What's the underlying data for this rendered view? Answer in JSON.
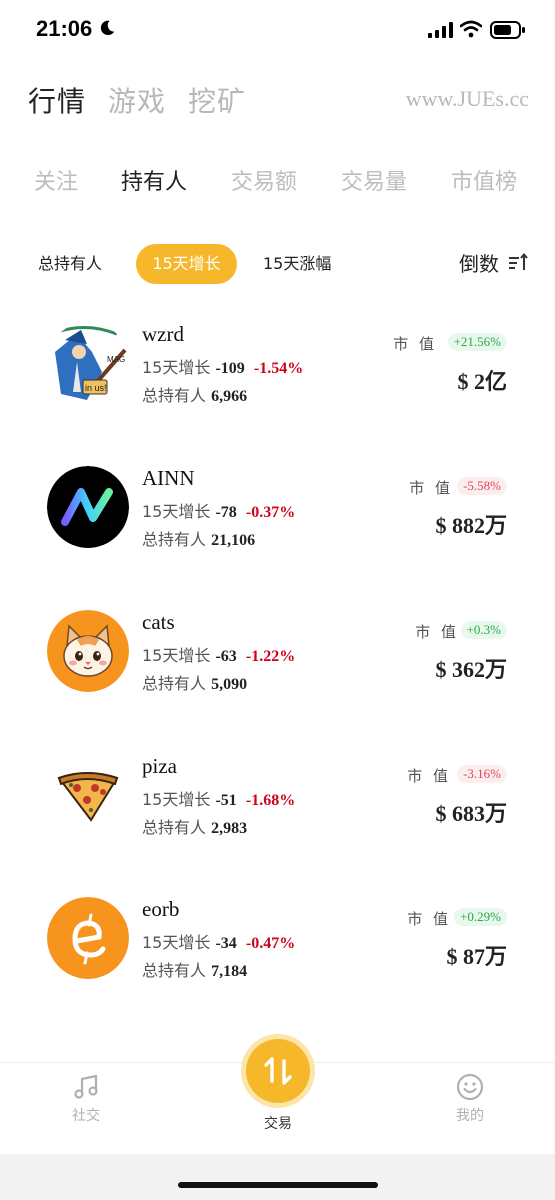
{
  "status": {
    "time": "21:06"
  },
  "top_tabs": [
    {
      "label": "行情",
      "active": true
    },
    {
      "label": "游戏",
      "active": false
    },
    {
      "label": "挖矿",
      "active": false
    }
  ],
  "site_url": "www.JUEs.cc",
  "sub_tabs": [
    {
      "label": "关注",
      "active": false
    },
    {
      "label": "持有人",
      "active": true
    },
    {
      "label": "交易额",
      "active": false
    },
    {
      "label": "交易量",
      "active": false
    },
    {
      "label": "市值榜",
      "active": false
    }
  ],
  "filters": [
    {
      "label": "总持有人",
      "active": false
    },
    {
      "label": "15天增长",
      "active": true
    },
    {
      "label": "15天涨幅",
      "active": false
    }
  ],
  "sort_label": "倒数",
  "growth_label": "15天增长",
  "holders_label": "总持有人",
  "mcap_label": "市 值",
  "coins": [
    {
      "name": "wzrd",
      "growth": "-109",
      "growth_pct": "-1.54%",
      "holders": "6,966",
      "mcap_change": "+21.56%",
      "mcap_dir": "up",
      "mcap": "$ 2亿"
    },
    {
      "name": "AINN",
      "growth": "-78",
      "growth_pct": "-0.37%",
      "holders": "21,106",
      "mcap_change": "-5.58%",
      "mcap_dir": "down",
      "mcap": "$ 882万"
    },
    {
      "name": "cats",
      "growth": "-63",
      "growth_pct": "-1.22%",
      "holders": "5,090",
      "mcap_change": "+0.3%",
      "mcap_dir": "up",
      "mcap": "$ 362万"
    },
    {
      "name": "piza",
      "growth": "-51",
      "growth_pct": "-1.68%",
      "holders": "2,983",
      "mcap_change": "-3.16%",
      "mcap_dir": "down",
      "mcap": "$ 683万"
    },
    {
      "name": "eorb",
      "growth": "-34",
      "growth_pct": "-0.47%",
      "holders": "7,184",
      "mcap_change": "+0.29%",
      "mcap_dir": "up",
      "mcap": "$ 87万"
    }
  ],
  "nav": {
    "social": "社交",
    "trade": "交易",
    "mine": "我的"
  },
  "colors": {
    "accent": "#f6b82a",
    "negative": "#d0021b",
    "positive": "#2aa84a"
  }
}
